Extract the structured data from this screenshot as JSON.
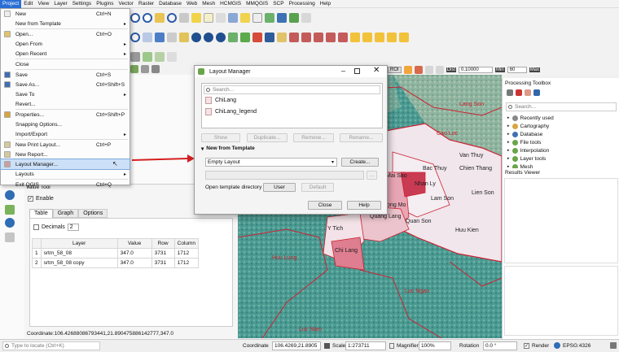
{
  "menubar": [
    "Project",
    "Edit",
    "View",
    "Layer",
    "Settings",
    "Plugins",
    "Vector",
    "Raster",
    "Database",
    "Web",
    "Mesh",
    "HCMGIS",
    "MMQGIS",
    "SCP",
    "Processing",
    "Help"
  ],
  "project_menu": {
    "items": [
      {
        "label": "New",
        "shortcut": "Ctrl+N",
        "sep": false
      },
      {
        "label": "New from Template",
        "arrow": true,
        "sep": true
      },
      {
        "label": "Open...",
        "shortcut": "Ctrl+O"
      },
      {
        "label": "Open From",
        "arrow": true
      },
      {
        "label": "Open Recent",
        "arrow": true,
        "sep": true
      },
      {
        "label": "Close",
        "sep": true
      },
      {
        "label": "Save",
        "shortcut": "Ctrl+S"
      },
      {
        "label": "Save As...",
        "shortcut": "Ctrl+Shift+S"
      },
      {
        "label": "Save To",
        "arrow": true
      },
      {
        "label": "Revert...",
        "sep": true
      },
      {
        "label": "Properties...",
        "shortcut": "Ctrl+Shift+P"
      },
      {
        "label": "Snapping Options..."
      },
      {
        "label": "Import/Export",
        "arrow": true,
        "sep": true
      },
      {
        "label": "New Print Layout...",
        "shortcut": "Ctrl+P"
      },
      {
        "label": "New Report..."
      },
      {
        "label": "Layout Manager...",
        "selected": true
      },
      {
        "label": "Layouts",
        "arrow": true,
        "sep": true
      },
      {
        "label": "Exit QGIS",
        "shortcut": "Ctrl+Q"
      }
    ]
  },
  "layout_manager": {
    "title": "Layout Manager",
    "search_placeholder": "Search...",
    "layouts": [
      "ChiLang",
      "ChiLang_legend"
    ],
    "show": "Show",
    "duplicate": "Duplicate...",
    "remove": "Remove...",
    "rename": "Rename...",
    "section": "New from Template",
    "template_value": "Empty Layout",
    "create": "Create...",
    "open_dir_label": "Open template directory",
    "user": "User",
    "default": "Default",
    "close": "Close",
    "help": "Help"
  },
  "toolbar_fields": {
    "dist_label": "Dist",
    "dist_value": "0.10000",
    "min_label": "Min",
    "min_value": "60",
    "max_label": "Max",
    "roi": "ROI"
  },
  "value_tool": {
    "title": "Value Tool",
    "enable": "Enable",
    "tabs": [
      "Table",
      "Graph",
      "Options"
    ],
    "decimals_label": "Decimals",
    "decimals_value": "2",
    "columns": [
      "Layer",
      "Value",
      "Row",
      "Column"
    ],
    "rows": [
      {
        "n": "1",
        "layer": "srtm_58_08",
        "value": "347.0",
        "row": "3731",
        "col": "1712"
      },
      {
        "n": "2",
        "layer": "srtm_58_08 copy",
        "value": "347.0",
        "row": "3731",
        "col": "1712"
      }
    ],
    "coordinate": "Coordinate:106.42688086793441,21.890475886142777,347.0"
  },
  "map_labels": [
    "Lang Son",
    "Cao Loc",
    "Van Thuy",
    "Bac Thuy",
    "Chien Thang",
    "Nhan Ly",
    "Lam Son",
    "Lien Son",
    "Quan Son",
    "Huu Kien",
    "Chi Lang",
    "Dong Mo",
    "Quang Lang",
    "Y Tich",
    "Mai Sao",
    "Huu Lung",
    "Luc Ngan",
    "Luc Nam"
  ],
  "processing": {
    "title": "Processing Toolbox",
    "search_placeholder": "Search...",
    "items": [
      "Recently used",
      "Cartography",
      "Database",
      "File tools",
      "Interpolation",
      "Layer tools",
      "Mesh"
    ]
  },
  "results_viewer": {
    "title": "Results Viewer"
  },
  "status": {
    "locate_placeholder": "Type to locate (Ctrl+K)",
    "coordinate_label": "Coordinate",
    "coordinate_value": "106.4269,21.8905",
    "scale_label": "Scale",
    "scale_value": "1:273711",
    "magnifier_label": "Magnifier",
    "magnifier_value": "100%",
    "rotation_label": "Rotation",
    "rotation_value": "0.0 °",
    "render_label": "Render",
    "crs": "EPSG:4326"
  }
}
